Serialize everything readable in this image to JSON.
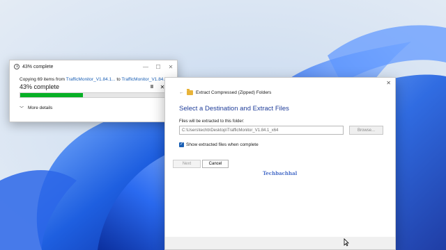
{
  "progress_dialog": {
    "title": "43% complete",
    "minimize_glyph": "—",
    "maximize_glyph": "☐",
    "close_glyph": "✕",
    "copy_prefix": "Copying 69 items from ",
    "copy_source": "TrafficMonitor_V1.84.1...",
    "copy_to": " to ",
    "copy_dest": "TrafficMonitor_V1.84.1...",
    "percent_label": "43% complete",
    "progress_fraction": 0.43,
    "pause_glyph": "II",
    "cancel_glyph": "✕",
    "more_details_label": "More details",
    "bar_color": "#06b025"
  },
  "extract_dialog": {
    "close_glyph": "✕",
    "header_title": "Extract Compressed (Zipped) Folders",
    "heading": "Select a Destination and Extract Files",
    "folder_label": "Files will be extracted to this folder:",
    "path_value": "C:\\Users\\techb\\Desktop\\TrafficMonitor_V1.84.1_x64",
    "browse_label": "Browse...",
    "checkbox_label": "Show extracted files when complete",
    "checkbox_checked": true,
    "watermark": "Techbachhal",
    "next_label": "Next",
    "cancel_label": "Cancel",
    "heading_color": "#1f3d99"
  }
}
